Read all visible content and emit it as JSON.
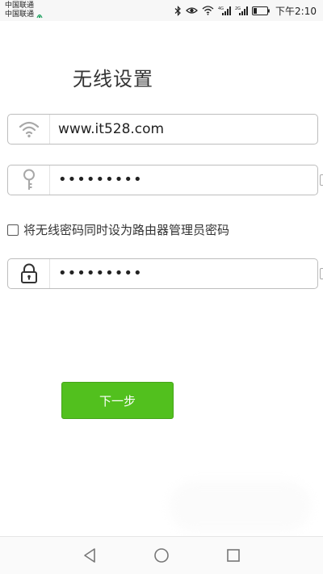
{
  "status_bar": {
    "carrier_1": "中国联通",
    "carrier_2": "中国联通",
    "time": "下午2:10",
    "icons": [
      "hd-icon",
      "bluetooth-icon",
      "eye-icon",
      "wifi-icon",
      "signal-4g-icon",
      "signal-2g-icon",
      "battery-icon"
    ]
  },
  "page": {
    "title": "无线设置"
  },
  "ssid_field": {
    "icon": "wifi-icon",
    "value": "www.it528.com"
  },
  "wifi_password_field": {
    "icon": "key-icon",
    "value": "•••••••••"
  },
  "sync_option": {
    "label": "将无线密码同时设为路由器管理员密码",
    "checked": false
  },
  "admin_password_field": {
    "icon": "lock-icon",
    "value": "•••••••••"
  },
  "next_button": {
    "label": "下一步",
    "color": "#52c01e"
  },
  "nav_bar": {
    "icons": [
      "back-icon",
      "home-icon",
      "recents-icon"
    ]
  }
}
